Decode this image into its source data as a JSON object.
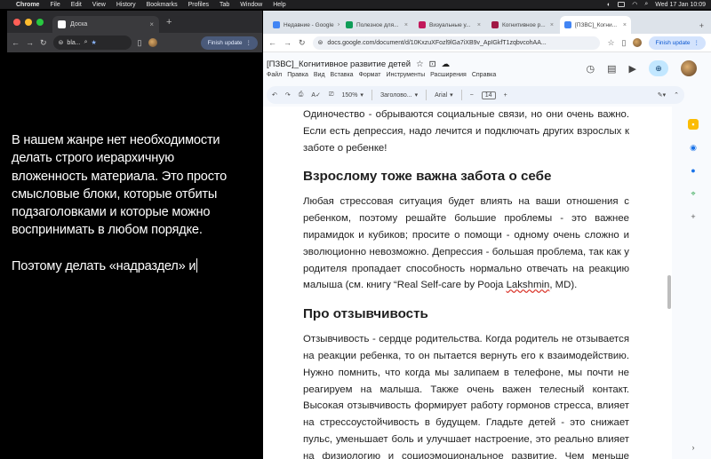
{
  "menubar": {
    "app": "Chrome",
    "items": [
      "File",
      "Edit",
      "View",
      "History",
      "Bookmarks",
      "Profiles",
      "Tab",
      "Window",
      "Help"
    ],
    "clock": "Wed 17 Jan  10:09"
  },
  "left_window": {
    "tab_title": "Доска",
    "address": "bla...",
    "finish_update": "Finish update",
    "paragraphs": [
      "В нашем жанре нет необходимости делать строго иерархичную вложенность материала. Это просто смысловые блоки, которые отбиты подзаголовками и которые можно воспринимать в любом порядке.",
      "Поэтому делать «надраздел» и"
    ]
  },
  "right_window": {
    "tabs": [
      {
        "title": "Недавние - Google",
        "color": "#4285f4"
      },
      {
        "title": "Полезное для...",
        "color": "#0f9d58"
      },
      {
        "title": "Визуальные у...",
        "color": "#c2185b"
      },
      {
        "title": "Когнитивное р...",
        "color": "#a01845"
      },
      {
        "title": "[ПЗВС]_Когни...",
        "color": "#4285f4"
      }
    ],
    "url": "docs.google.com/document/d/10KxzuXFozl9lGa7iXB9v_ApIGkfT1zqbvcohAA...",
    "finish_update": "Finish update",
    "doc_title": "[ПЗВС]_Когнитивное развитие детей",
    "doc_menu": [
      "Файл",
      "Правка",
      "Вид",
      "Вставка",
      "Формат",
      "Инструменты",
      "Расширения",
      "Справка"
    ],
    "toolbar": {
      "zoom": "150%",
      "style": "Заголово...",
      "font": "Arial",
      "size": "14"
    },
    "content": {
      "p1": "Одиночество - обрываются социальные связи, но они очень важно. Если есть депрессия, надо лечится и подключать других взрослых к заботе о ребенке!",
      "h1": "Взрослому тоже важна забота о себе",
      "p2a": "Любая стрессовая ситуация будет влиять на ваши отношения с ребенком, поэтому решайте большие проблемы - это важнее пирамидок и кубиков; просите о помощи - одному очень сложно и эволюционно невозможно. Депрессия - большая проблема, так как у родителя пропадает способность нормально отвечать на реакцию  малыша (см. книгу “Real Self-care by Pooja ",
      "p2b": "Lakshmin",
      "p2c": ", MD).",
      "h2": "Про отзывчивость",
      "p3": "Отзывчивость - сердце родительства. Когда родитель не отзывается на реакции ребенка, то он пытается вернуть его к взаимодействию. Нужно помнить, что когда мы залипаем в телефоне, мы почти не реагируем на малыша. Также очень важен телесный контакт. Высокая отзывчивость формирует работу гормонов стресса, влияет на стрессоустойчивость в будущем. Гладьте детей - это снижает пульс, уменьшает боль и улучшает настроение, это реально влияет на физиологию и социоэмоциональное развитие. Чем меньше ребенок, тем больше"
    }
  }
}
